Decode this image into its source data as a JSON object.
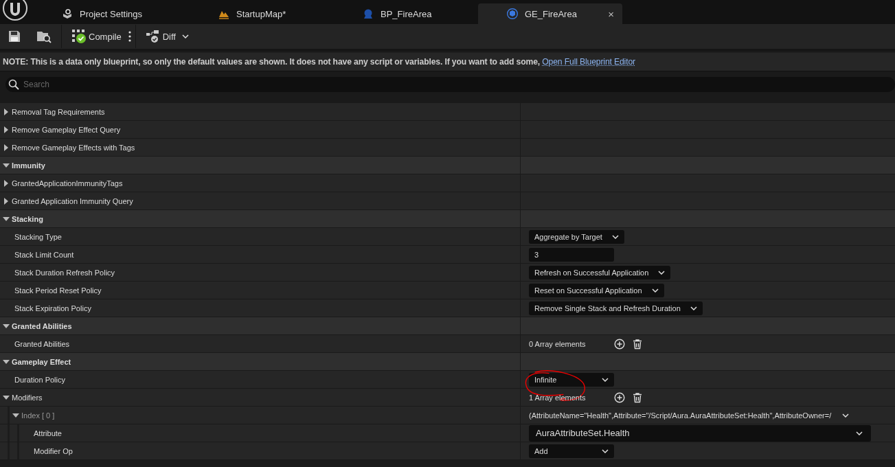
{
  "tabs": [
    {
      "label": "Project Settings",
      "kind": "settings",
      "selected": false
    },
    {
      "label": "StartupMap*",
      "kind": "map",
      "selected": false
    },
    {
      "label": "BP_FireArea",
      "kind": "blueprint",
      "selected": false
    },
    {
      "label": "GE_FireArea",
      "kind": "effect",
      "selected": true,
      "close": "×"
    }
  ],
  "toolbar": {
    "compile": "Compile",
    "diff": "Diff"
  },
  "note": {
    "text": "NOTE: This is a data only blueprint, so only the default values are shown.  It does not have any script or variables.  If you want to add some,",
    "link": "Open Full Blueprint Editor"
  },
  "search": {
    "placeholder": "Search"
  },
  "rows": [
    {
      "kind": "group",
      "label": "Removal Tag Requirements",
      "expanded": false
    },
    {
      "kind": "group",
      "label": "Remove Gameplay Effect Query",
      "expanded": false
    },
    {
      "kind": "group",
      "label": "Remove Gameplay Effects with Tags",
      "expanded": false
    },
    {
      "kind": "category",
      "label": "Immunity",
      "expanded": true,
      "children": [
        {
          "kind": "group",
          "label": "GrantedApplicationImmunityTags",
          "expanded": false
        },
        {
          "kind": "group",
          "label": "Granted Application Immunity Query",
          "expanded": false
        }
      ]
    },
    {
      "kind": "category",
      "label": "Stacking",
      "expanded": true,
      "children": [
        {
          "kind": "property",
          "label": "Stacking Type",
          "value": {
            "kind": "combo",
            "text": "Aggregate by Target"
          }
        },
        {
          "kind": "property",
          "label": "Stack Limit Count",
          "value": {
            "kind": "number",
            "text": "3"
          }
        },
        {
          "kind": "property",
          "label": "Stack Duration Refresh Policy",
          "value": {
            "kind": "combo",
            "text": "Refresh on Successful Application"
          }
        },
        {
          "kind": "property",
          "label": "Stack Period Reset Policy",
          "value": {
            "kind": "combo",
            "text": "Reset on Successful Application"
          }
        },
        {
          "kind": "property",
          "label": "Stack Expiration Policy",
          "value": {
            "kind": "combo",
            "text": "Remove Single Stack and Refresh Duration"
          }
        }
      ]
    },
    {
      "kind": "category",
      "label": "Granted Abilities",
      "expanded": true,
      "children": [
        {
          "kind": "property",
          "label": "Granted Abilities",
          "value": {
            "kind": "array",
            "text": "0 Array elements"
          }
        }
      ]
    },
    {
      "kind": "category",
      "label": "Gameplay Effect",
      "expanded": true,
      "children": [
        {
          "kind": "property",
          "label": "Duration Policy",
          "value": {
            "kind": "combo",
            "text": "Infinite",
            "circled": true
          }
        },
        {
          "kind": "group",
          "label": "Modifiers",
          "expanded": true,
          "value": {
            "kind": "array",
            "text": "1 Array elements"
          },
          "children": [
            {
              "kind": "group",
              "label": "Index [ 0 ]",
              "dim": true,
              "expanded": true,
              "value": {
                "kind": "struct",
                "text": "(AttributeName=\"Health\",Attribute=\"/Script/Aura.AuraAttributeSet:Health\",AttributeOwner=/"
              },
              "children": [
                {
                  "kind": "property",
                  "label": "Attribute",
                  "value": {
                    "kind": "wide-combo",
                    "text": "AuraAttributeSet.Health"
                  }
                },
                {
                  "kind": "property",
                  "label": "Modifier Op",
                  "value": {
                    "kind": "combo",
                    "text": "Add"
                  }
                }
              ]
            }
          ]
        }
      ]
    }
  ]
}
